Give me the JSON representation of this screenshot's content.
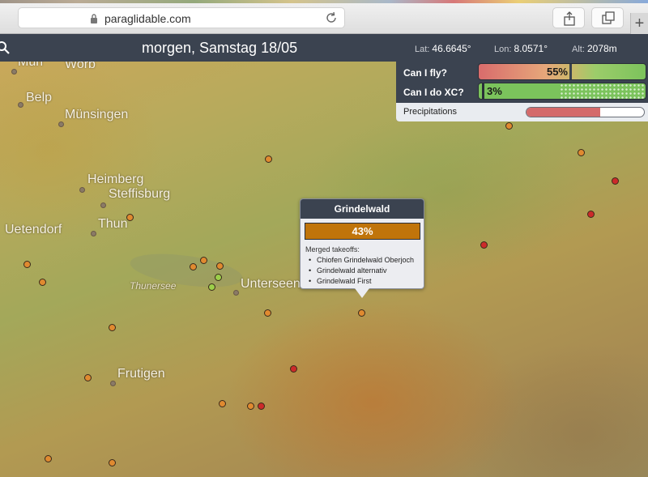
{
  "browser": {
    "url": "paraglidable.com",
    "icons": {
      "lock": "lock-icon",
      "reload": "reload-icon",
      "share": "share-icon",
      "tabs": "tabs-icon",
      "new_tab": "plus-icon"
    },
    "new_tab_label": "+"
  },
  "header": {
    "title": "morgen, Samstag 18/05",
    "lat_label": "Lat:",
    "lat_value": "46.6645°",
    "lon_label": "Lon:",
    "lon_value": "8.0571°",
    "alt_label": "Alt:",
    "alt_value": "2078m",
    "search_icon": "search-icon"
  },
  "forecast": {
    "fly_label": "Can I fly?",
    "fly_value": "55%",
    "fly_level": 0.55,
    "xc_label": "Can I do XC?",
    "xc_value": "3%",
    "xc_level": 0.03,
    "precip_label": "Precipitations",
    "precip_level": 0.63
  },
  "map": {
    "places": [
      "Muri",
      "Worb",
      "Belp",
      "Münsingen",
      "Heimberg",
      "Steffisburg",
      "Thun",
      "Uetendorf",
      "Unterseen",
      "Frutigen",
      "Thunersee"
    ]
  },
  "popup": {
    "title": "Grindelwald",
    "score": "43%",
    "subtitle": "Merged takeoffs:",
    "takeoffs": [
      "Chiofen Grindelwald Oberjoch",
      "Grindelwald alternativ",
      "Grindelwald First"
    ]
  },
  "colors": {
    "header_bg": "#3b4350",
    "popup_score": "#c0740a",
    "takeoff_good": "#e08a30",
    "takeoff_bad": "#cc2a2a",
    "takeoff_best": "#9ccf4a"
  }
}
